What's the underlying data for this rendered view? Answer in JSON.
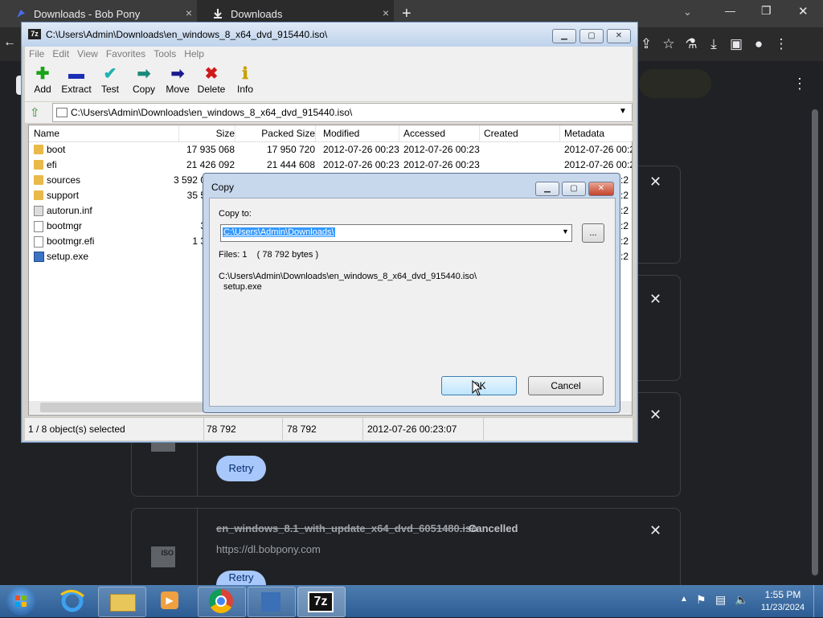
{
  "chrome": {
    "tabs": [
      {
        "title": "Downloads - Bob Pony",
        "close": "×"
      },
      {
        "title": "Downloads",
        "close": "×"
      }
    ],
    "new_tab": "+",
    "window_controls": {
      "minimize": "—",
      "restore": "❐",
      "close": "✕"
    },
    "toolbar_icons": [
      "share-icon",
      "star-icon",
      "labs-icon",
      "download-icon",
      "sidebar-icon",
      "profile-icon",
      "menu-icon"
    ],
    "content_menu": "⋮"
  },
  "downloads": {
    "retry_label": "Retry",
    "item": {
      "filename": "en_windows_8.1_with_update_x64_dvd_6051480.iso",
      "status": "Cancelled",
      "url": "https://dl.bobpony.com",
      "icon_text": "ISO"
    }
  },
  "sevenzip": {
    "title": "C:\\Users\\Admin\\Downloads\\en_windows_8_x64_dvd_915440.iso\\",
    "icon_text": "7z",
    "menu": [
      "File",
      "Edit",
      "View",
      "Favorites",
      "Tools",
      "Help"
    ],
    "toolbar": [
      {
        "label": "Add",
        "icon": "add-icon",
        "glyph": "✚",
        "color": "#1aa31a"
      },
      {
        "label": "Extract",
        "icon": "extract-icon",
        "glyph": "▬",
        "color": "#1a2fb5"
      },
      {
        "label": "Test",
        "icon": "test-icon",
        "glyph": "✔",
        "color": "#20b0b0"
      },
      {
        "label": "Copy",
        "icon": "copy-icon",
        "glyph": "➡",
        "color": "#1a8a7a"
      },
      {
        "label": "Move",
        "icon": "move-icon",
        "glyph": "➡",
        "color": "#1a1a90"
      },
      {
        "label": "Delete",
        "icon": "delete-icon",
        "glyph": "✖",
        "color": "#d01a1a"
      },
      {
        "label": "Info",
        "icon": "info-icon",
        "glyph": "ℹ",
        "color": "#c8a000"
      }
    ],
    "address": "C:\\Users\\Admin\\Downloads\\en_windows_8_x64_dvd_915440.iso\\",
    "columns": [
      "Name",
      "Size",
      "Packed Size",
      "Modified",
      "Accessed",
      "Created",
      "Metadata Cha..."
    ],
    "rows": [
      {
        "name": "boot",
        "type": "folder",
        "size": "17 935 068",
        "packed": "17 950 720",
        "modified": "2012-07-26 00:23",
        "accessed": "2012-07-26 00:23",
        "created": "",
        "meta": "2012-07-26 00:2"
      },
      {
        "name": "efi",
        "type": "folder",
        "size": "21 426 092",
        "packed": "21 444 608",
        "modified": "2012-07-26 00:23",
        "accessed": "2012-07-26 00:23",
        "created": "",
        "meta": "2012-07-26 00:2"
      },
      {
        "name": "sources",
        "type": "folder",
        "size": "3 592 0",
        "packed": "",
        "modified": "",
        "accessed": "",
        "created": "",
        "meta": ":2"
      },
      {
        "name": "support",
        "type": "folder",
        "size": "35 5",
        "packed": "",
        "modified": "",
        "accessed": "",
        "created": "",
        "meta": ":2"
      },
      {
        "name": "autorun.inf",
        "type": "inf",
        "size": "",
        "packed": "",
        "modified": "",
        "accessed": "",
        "created": "",
        "meta": ":2"
      },
      {
        "name": "bootmgr",
        "type": "file",
        "size": "3",
        "packed": "",
        "modified": "",
        "accessed": "",
        "created": "",
        "meta": ":2"
      },
      {
        "name": "bootmgr.efi",
        "type": "file",
        "size": "1 3",
        "packed": "",
        "modified": "",
        "accessed": "",
        "created": "",
        "meta": ":2"
      },
      {
        "name": "setup.exe",
        "type": "exe",
        "size": "",
        "packed": "",
        "modified": "",
        "accessed": "",
        "created": "",
        "meta": ":2"
      }
    ],
    "status": {
      "selection": "1 / 8 object(s) selected",
      "size": "78 792",
      "packed": "78 792",
      "modified": "2012-07-26 00:23:07"
    }
  },
  "copy_dialog": {
    "title": "Copy",
    "copy_to_label": "Copy to:",
    "path_value": "C:\\Users\\Admin\\Downloads\\",
    "browse_label": "...",
    "files_info": "Files: 1    ( 78 792 bytes )",
    "source_path": "C:\\Users\\Admin\\Downloads\\en_windows_8_x64_dvd_915440.iso\\",
    "source_file": "setup.exe",
    "ok_label": "OK",
    "cancel_label": "Cancel"
  },
  "taskbar": {
    "time": "1:55 PM",
    "date": "11/23/2024",
    "apps": [
      "ie-icon",
      "explorer-icon",
      "media-player-icon",
      "chrome-icon",
      "installer-icon",
      "7zip-icon"
    ],
    "sevenzip_icon_text": "7z",
    "tray_arrow": "▲"
  },
  "colors": {
    "selection": "#3399ff",
    "chrome_bg": "#202124",
    "retry_bg": "#a8c7fa"
  }
}
